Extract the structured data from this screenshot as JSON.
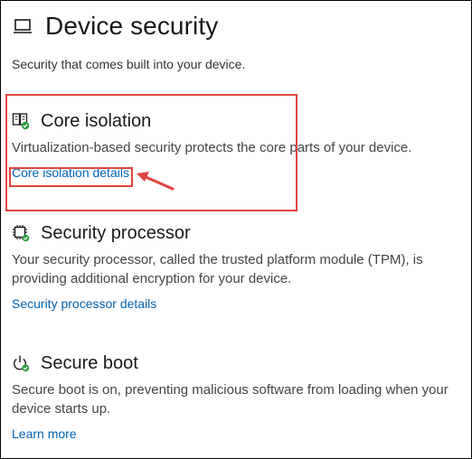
{
  "header": {
    "title": "Device security",
    "subtitle": "Security that comes built into your device."
  },
  "sections": [
    {
      "title": "Core isolation",
      "description": "Virtualization-based security protects the core parts of your device.",
      "link": "Core isolation details",
      "icon": "core-isolation-icon"
    },
    {
      "title": "Security processor",
      "description": "Your security processor, called the trusted platform module (TPM), is providing additional encryption for your device.",
      "link": "Security processor details",
      "icon": "chip-icon"
    },
    {
      "title": "Secure boot",
      "description": "Secure boot is on, preventing malicious software from loading when your device starts up.",
      "link": "Learn more",
      "icon": "power-icon"
    }
  ],
  "colors": {
    "link": "#0063b1",
    "annotation": "#e0443e",
    "status_ok": "#2a9d3c"
  }
}
